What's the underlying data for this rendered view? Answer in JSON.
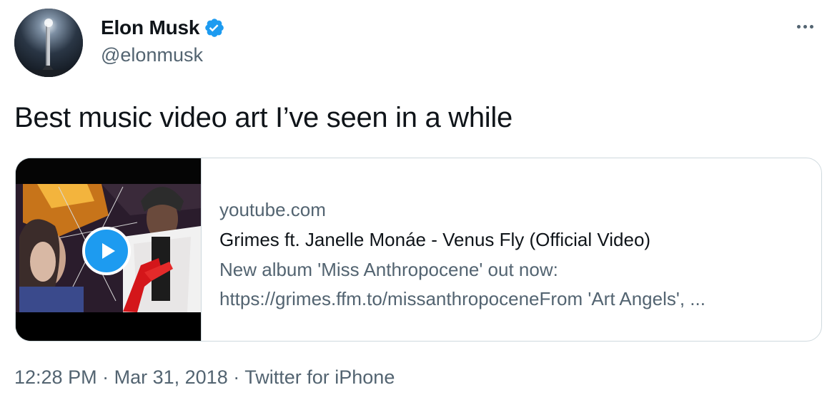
{
  "author": {
    "display_name": "Elon Musk",
    "handle": "@elonmusk",
    "verified": true,
    "verified_badge_color": "#1d9bf0"
  },
  "tweet": {
    "text": "Best music video art I’ve seen in a while"
  },
  "card": {
    "domain": "youtube.com",
    "title": "Grimes ft. Janelle Monáe - Venus Fly (Official Video)",
    "description_line1": "New album 'Miss Anthropocene' out now:",
    "description_line2": "https://grimes.ffm.to/missanthropoceneFrom 'Art Angels', ...",
    "play_icon": "play-icon"
  },
  "meta": {
    "time": "12:28 PM",
    "separator": "·",
    "date": "Mar 31, 2018",
    "source": "Twitter for iPhone"
  },
  "colors": {
    "accent": "#1d9bf0",
    "text_primary": "#0f1419",
    "text_secondary": "#536471",
    "border": "#cfd9de"
  }
}
